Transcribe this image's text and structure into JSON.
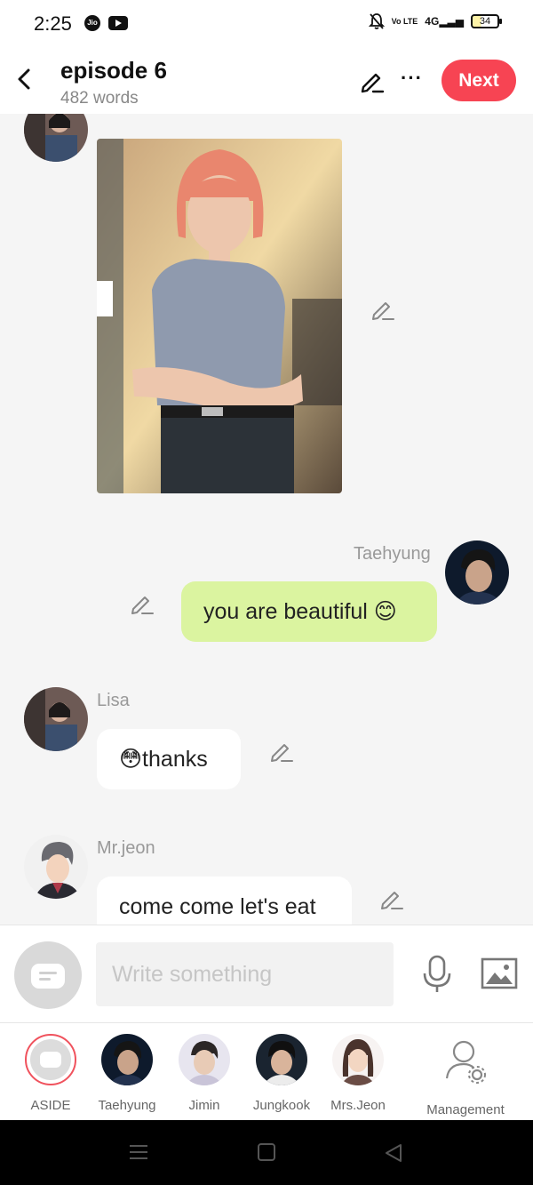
{
  "status_bar": {
    "time": "2:25",
    "jio_label": "Jio",
    "volte": "Vo LTE",
    "network": "4G",
    "battery": "34"
  },
  "header": {
    "back_icon": "chevron-left-icon",
    "title": "episode 6",
    "word_count": "482 words",
    "edit_icon": "pencil-icon",
    "more_icon": "more-horizontal-icon",
    "more_label": "···",
    "next_label": "Next",
    "accent_color": "#f74453"
  },
  "messages": [
    {
      "speaker": "Lisa",
      "side": "left",
      "type": "image",
      "image_desc": "photo-of-woman-with-pink-bob"
    },
    {
      "speaker": "Taehyung",
      "side": "right",
      "type": "text",
      "text": "you are beautiful 😊",
      "bubble_color": "#dbf4a0"
    },
    {
      "speaker": "Lisa",
      "side": "left",
      "type": "text",
      "text": "😳thanks",
      "bubble_color": "#ffffff"
    },
    {
      "speaker": "Mr.jeon",
      "side": "left",
      "type": "text",
      "text": "come come let's eat",
      "bubble_color": "#ffffff"
    }
  ],
  "composer": {
    "placeholder": "Write something",
    "mic_icon": "microphone-icon",
    "image_icon": "image-icon"
  },
  "characters": [
    {
      "label": "ASIDE",
      "selected": true
    },
    {
      "label": "Taehyung"
    },
    {
      "label": "Jimin"
    },
    {
      "label": "Jungkook"
    },
    {
      "label": "Mrs.Jeon"
    },
    {
      "label": "Management",
      "icon": "user-settings-icon"
    }
  ],
  "navbar": {
    "menu_icon": "menu-icon",
    "home_icon": "home-square-icon",
    "back_icon": "back-triangle-icon"
  }
}
